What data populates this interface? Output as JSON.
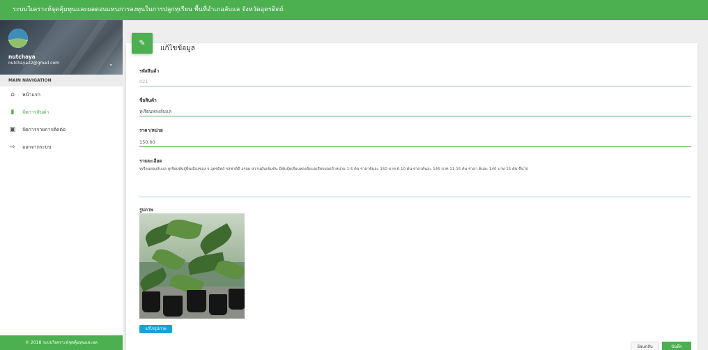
{
  "app": {
    "title": "ระบบวิเคราะห์จุดคุ้มทุนและผลตอบแทนการลงทุนในการปลูกทุเรียน พื้นที่อำเภอลับแล จังหวัดอุตรดิตถ์"
  },
  "user": {
    "name": "nutchaya",
    "email": "nutchaya22@gmail.com"
  },
  "sidebar": {
    "header": "MAIN NAVIGATION",
    "items": [
      {
        "label": "หน้าแรก",
        "icon": "home-icon",
        "active": false
      },
      {
        "label": "จัดการสินค้า",
        "icon": "file-icon",
        "active": true
      },
      {
        "label": "จัดการรายการติดต่อ",
        "icon": "contact-card-icon",
        "active": false
      },
      {
        "label": "ออกจากระบบ",
        "icon": "logout-icon",
        "active": false
      }
    ],
    "footer": "© 2018 ระบบวิเคราะห์จุดคุ้มทุนและผล"
  },
  "form": {
    "title": "แก้ไขข้อมูล",
    "product_code": {
      "label": "รหัสสินค้า",
      "value": "021"
    },
    "product_name": {
      "label": "ชื่อสินค้า",
      "value": "ทุเรียนหลงลับแล"
    },
    "price": {
      "label": "ราคา/หน่วย",
      "value": "150.00"
    },
    "details": {
      "label": "รายละเอียด",
      "value": "ทุเรียนหลงลับแล ทุเรียนพันธุ์พื้นเมืองของ จ.อุตรดิตถ์ รสชาติดี อร่อย หวานมันเข้มข้น มีพันธุ์ทุเรียนหลงลับแลเสียบยอดจำหน่าย 1-5 ต้น ราคาต้นละ 150 บาท 6-10 ต้น ราคาต้นละ 145 บาท 11-15 ต้น ราคา ต้นละ 140 บาท 15 ต้น ขึ้นไป"
    },
    "image": {
      "label": "รูปภาพ"
    },
    "upload_button": "แก้ไขรูปภาพ",
    "back_button": "ย้อนกลับ",
    "save_button": "บันทึก"
  },
  "colors": {
    "primary": "#4caf50",
    "upload": "#17a2d8"
  }
}
